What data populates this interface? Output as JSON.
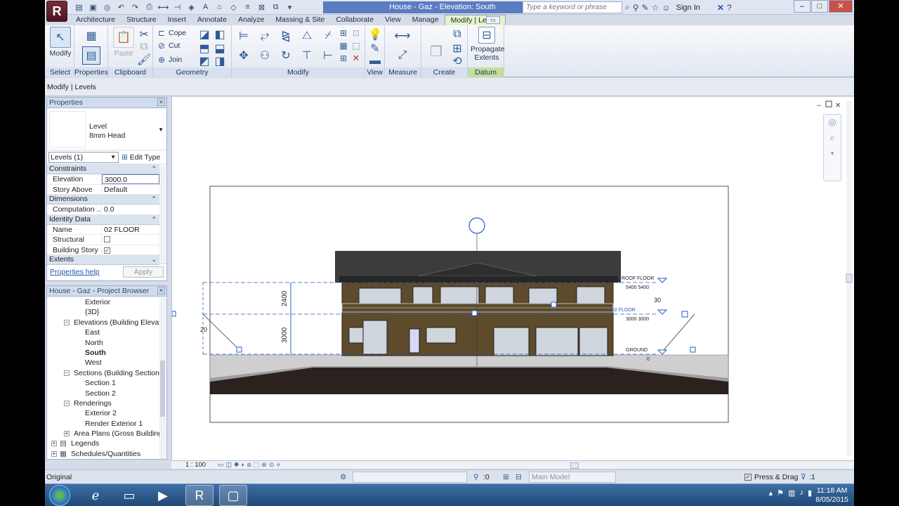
{
  "title": {
    "doc_title": "House - Gaz - Elevation: South",
    "search_placeholder": "Type a keyword or phrase",
    "sign_in": "Sign In",
    "minimize": "–",
    "maximize": "□",
    "close": "✕",
    "help": "?"
  },
  "ribbon": {
    "tabs": [
      "Architecture",
      "Structure",
      "Insert",
      "Annotate",
      "Analyze",
      "Massing & Site",
      "Collaborate",
      "View",
      "Manage",
      "Modify | Levels"
    ],
    "active_tab": "Modify | Levels",
    "panels": {
      "select": "Select",
      "properties": "Properties",
      "clipboard": "Clipboard",
      "geometry": "Geometry",
      "modify": "Modify",
      "view": "View",
      "measure": "Measure",
      "create": "Create",
      "datum": "Datum"
    },
    "buttons": {
      "modify": "Modify",
      "paste": "Paste",
      "cope": "Cope",
      "cut": "Cut",
      "join": "Join",
      "propagate_line1": "Propagate",
      "propagate_line2": "Extents"
    }
  },
  "options_bar": {
    "text": "Modify | Levels"
  },
  "properties": {
    "title": "Properties",
    "type_line1": "Level",
    "type_line2": "8mm Head",
    "instance_selector": "Levels (1)",
    "edit_type": "Edit Type",
    "groups": {
      "constraints": "Constraints",
      "dimensions": "Dimensions",
      "identity": "Identity Data",
      "extents": "Extents"
    },
    "rows": {
      "elevation_name": "Elevation",
      "elevation_value": "3000.0",
      "story_above_name": "Story Above",
      "story_above_value": "Default",
      "computation_name": "Computation ...",
      "computation_value": "0.0",
      "name_name": "Name",
      "name_value": "02 FLOOR",
      "structural_name": "Structural",
      "building_story_name": "Building Story"
    },
    "help": "Properties help",
    "apply": "Apply"
  },
  "browser": {
    "title": "House - Gaz - Project Browser",
    "nodes": {
      "exterior": "Exterior",
      "threed": "{3D}",
      "elevations": "Elevations (Building Elevatio",
      "east": "East",
      "north": "North",
      "south": "South",
      "west": "West",
      "sections": "Sections (Building Section)",
      "section1": "Section 1",
      "section2": "Section 2",
      "renderings": "Renderings",
      "exterior2": "Exterior 2",
      "render_exterior1": "Render Exterior 1",
      "area_plans": "Area Plans (Gross Building)",
      "legends": "Legends",
      "schedules": "Schedules/Quantities"
    }
  },
  "drawing": {
    "dim_2400": "2400",
    "dim_3000": "3000",
    "dim_20": "20",
    "dim_30": "30",
    "roof_label": "ROOF FLOOR",
    "roof_values": "5400 5400",
    "floor2_label": "02 FLOOR",
    "floor2_values": "3000 3000",
    "ground_label": "GROUND",
    "ground_value": "0"
  },
  "view_control": {
    "scale": "1 : 100"
  },
  "status": {
    "text": "Original",
    "editable_count": ":0",
    "main_model": "Main Model",
    "press_drag": "Press & Drag",
    "filter_count": ":1"
  },
  "taskbar": {
    "time": "11:18 AM",
    "date": "8/05/2015"
  },
  "colors": {
    "accent": "#5a7cc0",
    "context_tab": "#c4dea0",
    "selection_blue": "#1f5fc8"
  }
}
